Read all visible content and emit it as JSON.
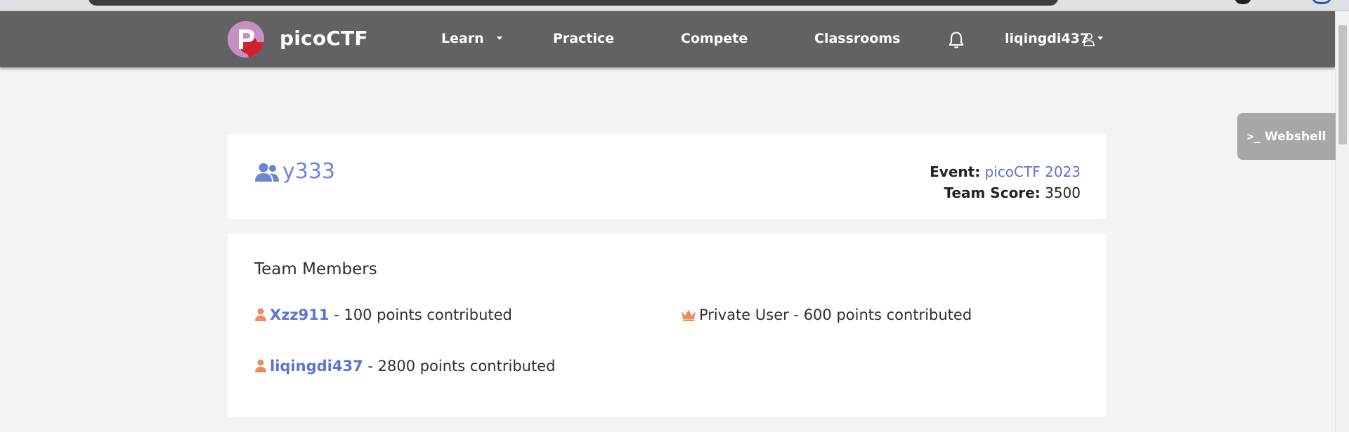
{
  "nav": {
    "brand": "picoCTF",
    "items": [
      {
        "label": "Learn"
      },
      {
        "label": "Practice"
      },
      {
        "label": "Compete"
      },
      {
        "label": "Classrooms"
      }
    ],
    "user": "liqingdi437",
    "icons": {
      "notifications": "bell-icon",
      "user": "user-icon"
    }
  },
  "webshell": {
    "label": "Webshell",
    "prompt": ">_"
  },
  "team": {
    "name": "y333",
    "event_label": "Event:",
    "event_value": "picoCTF 2023",
    "score_label": "Team Score:",
    "score_value": "3500"
  },
  "members": {
    "title": "Team Members",
    "list": [
      {
        "name": "Xzz911",
        "suffix": " - 100 points contributed",
        "icon": "person-icon"
      },
      {
        "name": "Private User",
        "suffix": " - 600 points contributed",
        "icon": "crown-icon"
      },
      {
        "name": "liqingdi437",
        "suffix": " - 2800 points contributed",
        "icon": "person-icon"
      }
    ]
  },
  "colors": {
    "navbar": "#626262",
    "link": "#5b74d2",
    "accent_orange": "#f08a63",
    "logo_red": "#d0222e",
    "logo_pink": "#c790c4"
  }
}
